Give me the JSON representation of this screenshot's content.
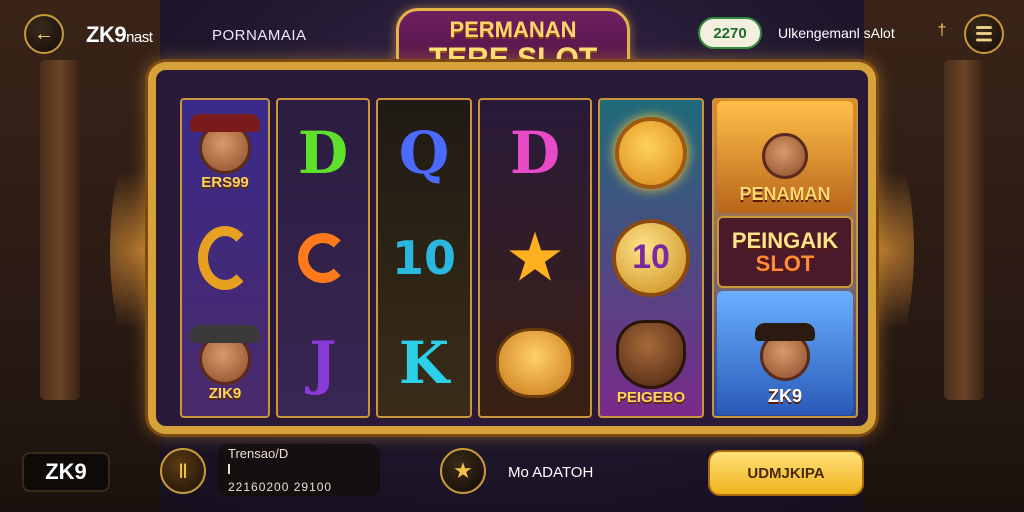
{
  "header": {
    "brand": "ZK9",
    "brand_suffix": "nast",
    "game_name": "PORNAMAIA",
    "title_line1": "PERMANAN",
    "title_line2": "TERE SLOT",
    "balance": "2270",
    "promo_text": "Ulkengemanl sAlot"
  },
  "icons": {
    "back": "back-arrow-icon",
    "menu": "menu-icon",
    "info": "info-icon",
    "bet": "coin-stack-icon",
    "auto": "star-icon"
  },
  "reels": {
    "col1": {
      "top_label": "ERS99",
      "bottom_label": "ZIK9"
    },
    "col2": {
      "top_letter": "D",
      "bottom_letter": "J"
    },
    "col3": {
      "top_letter": "Q",
      "mid_number": "10",
      "bottom_letter": "K"
    },
    "col4": {
      "top_letter": "D"
    },
    "col5": {
      "mid_number": "10",
      "bottom_label": "PEIGEBO"
    },
    "col6": {
      "card1_label": "PENAMAN",
      "card2_line1": "PEINGAIK",
      "card2_line2": "SLOT",
      "card3_label": "ZK9"
    }
  },
  "footer": {
    "logo": "ZK9",
    "bet_label": "Trensao/D",
    "bet_marker": "I",
    "bet_value": "22160200 29100",
    "auto_label": "Mo ADATOH",
    "spin_label": "UDMJKIPA"
  },
  "colors": {
    "gold": "#d7a23a",
    "title_plate": "#6e1f5e",
    "balance_green": "#2f8b3a",
    "spin_button": "#f0b21c"
  }
}
